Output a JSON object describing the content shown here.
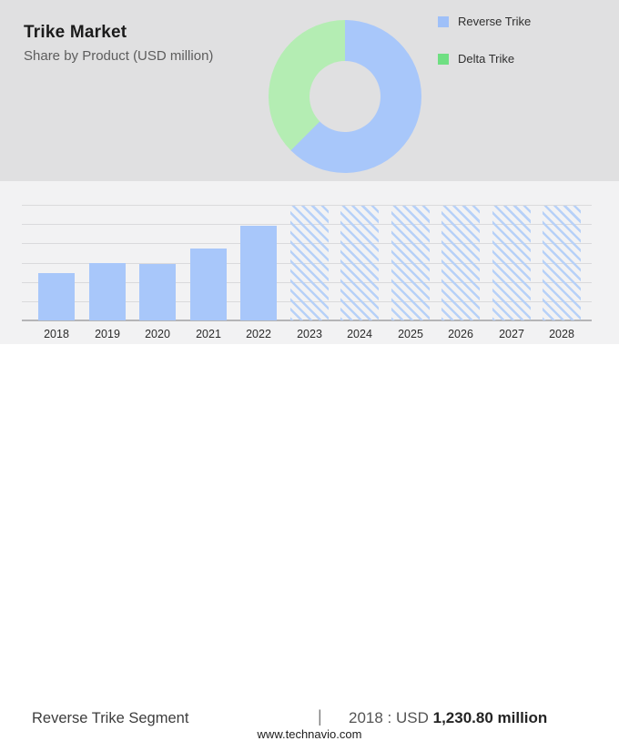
{
  "header": {
    "title": "Trike Market",
    "subtitle": "Share by Product (USD million)",
    "legend": [
      {
        "label": "Reverse Trike",
        "color": "#9fc0f8"
      },
      {
        "label": "Delta Trike",
        "color": "#6fdf82"
      }
    ]
  },
  "theme": {
    "top_panel_bg": "#e0e0e1",
    "chart_panel_bg": "#f2f2f3",
    "footer_bg": "#ffffff",
    "bar_blue": "#a8c7fa",
    "donut_blue": "#a8c7fa",
    "donut_green": "#b4edb3",
    "hatch_stripe_blue": "#b7d1f8",
    "gridline_gray": "#dadadc",
    "axis_gray": "#b5b5b7"
  },
  "chart_data": [
    {
      "type": "pie",
      "donut": true,
      "labels": [
        "Reverse Trike",
        "Delta Trike"
      ],
      "values": [
        62.5,
        37.5
      ],
      "colors": [
        "#a8c7fa",
        "#b4edb3"
      ],
      "start_angle_deg": 0,
      "direction": "clockwise",
      "legend_position": "right"
    },
    {
      "type": "bar",
      "title": "Trike Market by year (USD million)",
      "categories": [
        "2018",
        "2019",
        "2020",
        "2021",
        "2022",
        "2023",
        "2024",
        "2025",
        "2026",
        "2027",
        "2028"
      ],
      "values": [
        1230.8,
        1480,
        1460,
        1875,
        2450,
        null,
        null,
        null,
        null,
        null,
        null
      ],
      "forecast_categories": [
        "2023",
        "2024",
        "2025",
        "2026",
        "2027",
        "2028"
      ],
      "forecast_style": "full-height diagonal hatch",
      "xlabel": "",
      "ylabel": "USD million",
      "ylim": [
        0,
        3000
      ],
      "gridline_step": 500,
      "grid": true,
      "bar_color": "#a8c7fa"
    }
  ],
  "footer": {
    "segment_label": "Reverse Trike Segment",
    "separator": "|",
    "value_prefix": "2018 : USD ",
    "value_bold": "1,230.80 million",
    "website": "www.technavio.com"
  }
}
